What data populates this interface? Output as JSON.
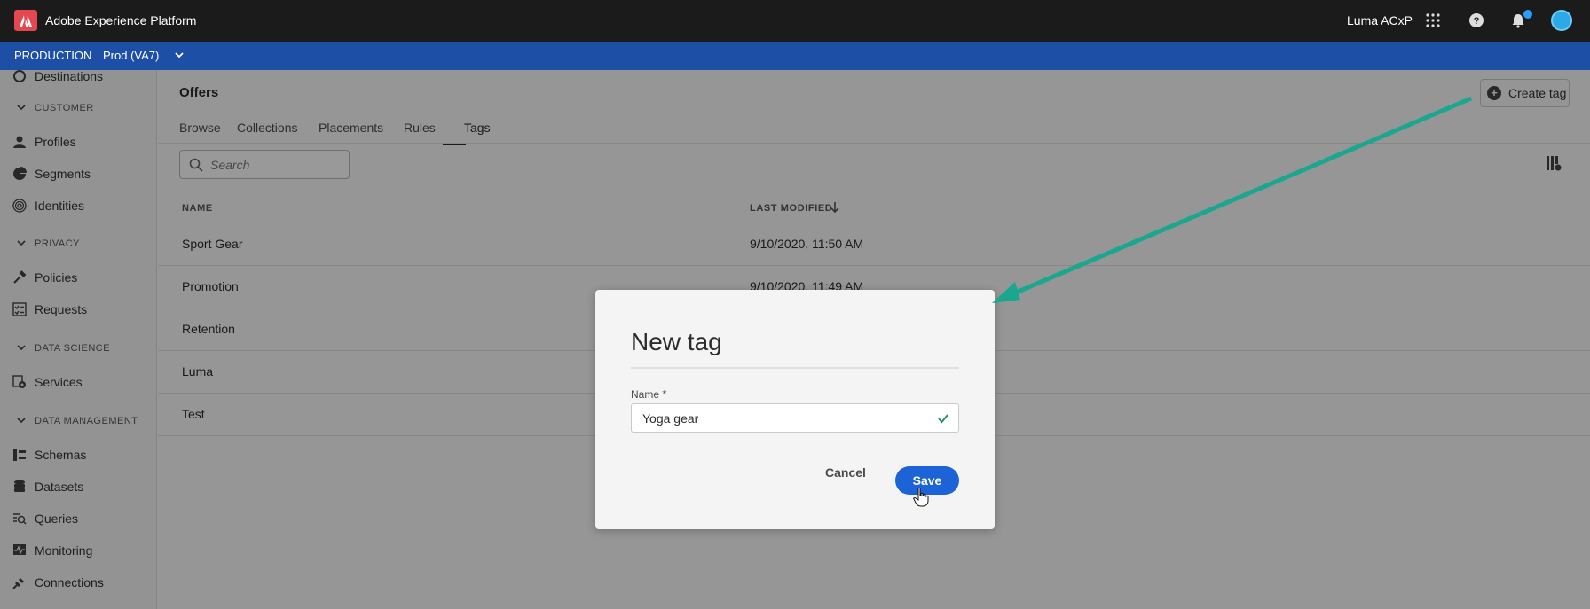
{
  "app": {
    "title": "Adobe Experience Platform",
    "org": "Luma ACxP"
  },
  "sandbox": {
    "type": "PRODUCTION",
    "name": "Prod (VA7)"
  },
  "sidebar": {
    "partial_item": "Destinations",
    "sections": [
      {
        "label": "CUSTOMER",
        "items": [
          "Profiles",
          "Segments",
          "Identities"
        ]
      },
      {
        "label": "PRIVACY",
        "items": [
          "Policies",
          "Requests"
        ]
      },
      {
        "label": "DATA SCIENCE",
        "items": [
          "Services"
        ]
      },
      {
        "label": "DATA MANAGEMENT",
        "items": [
          "Schemas",
          "Datasets",
          "Queries",
          "Monitoring",
          "Connections"
        ]
      }
    ]
  },
  "page": {
    "title": "Offers",
    "tabs": [
      "Browse",
      "Collections",
      "Placements",
      "Rules",
      "Tags"
    ],
    "active_tab": "Tags",
    "create_button": "Create tag",
    "search_placeholder": "Search"
  },
  "table": {
    "columns": [
      "NAME",
      "LAST MODIFIED"
    ],
    "sort_column": "LAST MODIFIED",
    "sort_direction": "descending",
    "rows": [
      {
        "name": "Sport Gear",
        "modified": "9/10/2020, 11:50 AM"
      },
      {
        "name": "Promotion",
        "modified": "9/10/2020, 11:49 AM"
      },
      {
        "name": "Retention",
        "modified": ""
      },
      {
        "name": "Luma",
        "modified": ""
      },
      {
        "name": "Test",
        "modified": ""
      }
    ]
  },
  "dialog": {
    "title": "New tag",
    "field_label": "Name",
    "field_value": "Yoga gear",
    "cancel_label": "Cancel",
    "save_label": "Save"
  },
  "colors": {
    "topbar": "#1b1b1b",
    "sandbox_bar": "#1e4fa6",
    "primary_button": "#1b63d6",
    "annotation_arrow": "#1aa68f",
    "valid_check": "#268e6c"
  }
}
